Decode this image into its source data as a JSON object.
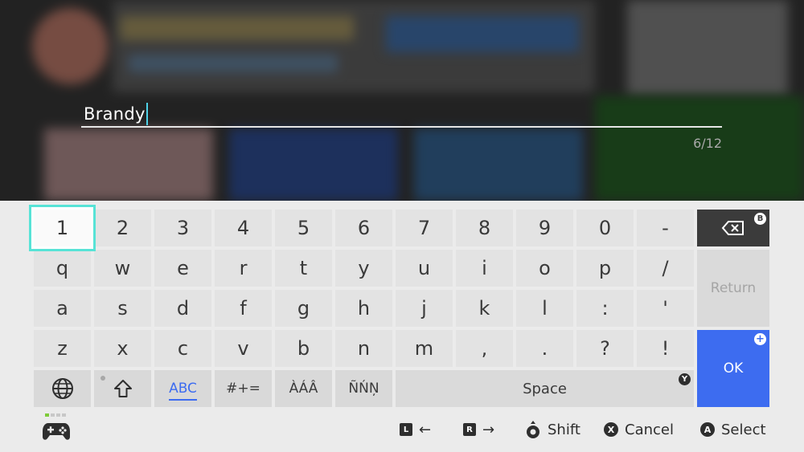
{
  "input": {
    "value": "Brandy",
    "char_count": "6/12"
  },
  "keyboard": {
    "rows": [
      [
        "1",
        "2",
        "3",
        "4",
        "5",
        "6",
        "7",
        "8",
        "9",
        "0",
        "-"
      ],
      [
        "q",
        "w",
        "e",
        "r",
        "t",
        "y",
        "u",
        "i",
        "o",
        "p",
        "/"
      ],
      [
        "a",
        "s",
        "d",
        "f",
        "g",
        "h",
        "j",
        "k",
        "l",
        ":",
        "'"
      ],
      [
        "z",
        "x",
        "c",
        "v",
        "b",
        "n",
        "m",
        ",",
        ".",
        "?",
        "!"
      ]
    ],
    "selected_key": "1",
    "mode_abc": "ABC",
    "mode_symbols": "#+=",
    "mode_accent1": "ÀÁÂ",
    "mode_accent2": "ÑŃŅ",
    "space_label": "Space",
    "space_badge": "Y",
    "return_label": "Return",
    "ok_label": "OK",
    "ok_badge": "+",
    "backspace_badge": "B",
    "accent_color": "#3d6cf0",
    "selection_color": "#57e3d6"
  },
  "footer": {
    "hints": [
      {
        "button": "L",
        "label": "←"
      },
      {
        "button": "R",
        "label": "→"
      },
      {
        "button": "stick",
        "label": "Shift"
      },
      {
        "button": "X",
        "label": "Cancel"
      },
      {
        "button": "A",
        "label": "Select"
      }
    ],
    "controller_icon": "controller-icon"
  }
}
